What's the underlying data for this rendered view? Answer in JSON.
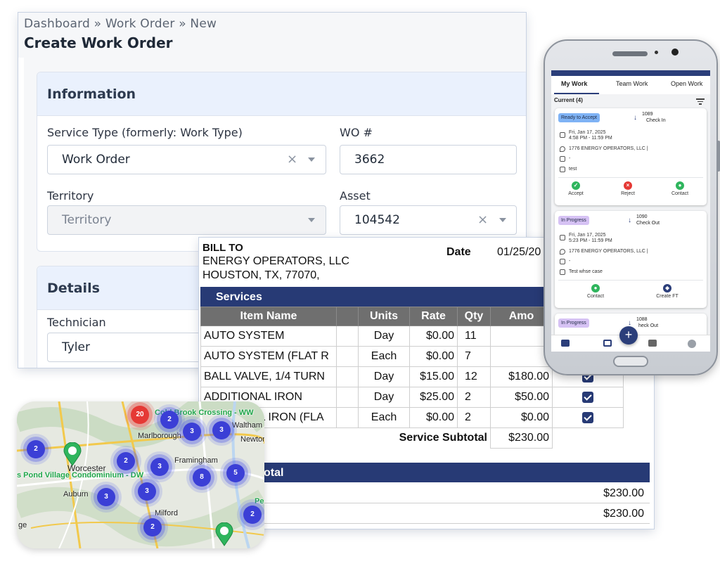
{
  "work_order_form": {
    "breadcrumb": "Dashboard » Work Order » New",
    "title": "Create Work Order",
    "information": {
      "heading": "Information",
      "service_type_label": "Service Type (formerly: Work Type)",
      "service_type_value": "Work Order",
      "wo_label": "WO #",
      "wo_value": "3662",
      "territory_label": "Territory",
      "territory_placeholder": "Territory",
      "asset_label": "Asset",
      "asset_value": "104542"
    },
    "details": {
      "heading": "Details",
      "technician_label": "Technician",
      "technician_value": "Tyler"
    }
  },
  "bill": {
    "bill_to_label": "BILL TO",
    "company": "ENERGY OPERATORS, LLC",
    "address": "HOUSTON,   TX,   77070,",
    "date_label": "Date",
    "date_value": "01/25/20",
    "services_heading": "Services",
    "columns": [
      "Item Name",
      "",
      "Units",
      "Rate",
      "Qty",
      "Amo",
      ""
    ],
    "rows": [
      {
        "item": "AUTO SYSTEM",
        "units": "Day",
        "rate": "$0.00",
        "qty": "11",
        "amount": "",
        "checked": false
      },
      {
        "item": "AUTO SYSTEM (FLAT R",
        "units": "Each",
        "rate": "$0.00",
        "qty": "7",
        "amount": "",
        "checked": false
      },
      {
        "item": "BALL VALVE, 1/4 TURN",
        "units": "Day",
        "rate": "$15.00",
        "qty": "12",
        "amount": "$180.00",
        "checked": true
      },
      {
        "item": "ADDITIONAL IRON",
        "units": "Day",
        "rate": "$25.00",
        "qty": "2",
        "amount": "$50.00",
        "checked": true
      },
      {
        "item": "AL IRON (FLA",
        "units": "Each",
        "rate": "$0.00",
        "qty": "2",
        "amount": "$0.00",
        "checked": true
      }
    ],
    "subtotal_label": "Service Subtotal",
    "subtotal_value": "$230.00",
    "total_heading": "otal",
    "total_line_1": "$230.00",
    "total_line_2": "$230.00"
  },
  "map": {
    "places": {
      "cold_brook": "Cold Brook Crossing - WW",
      "waltham": "Waltham",
      "marlborough": "Marlborough",
      "newton": "Newton",
      "worcester": "Worcester",
      "pond_village": "s Pond Village Condominium - DW",
      "framingham": "Framingham",
      "auburn": "Auburn",
      "milford": "Milford",
      "ge": "ge",
      "pe": "Pe"
    },
    "clusters": [
      "20",
      "2",
      "3",
      "3",
      "2",
      "2",
      "3",
      "8",
      "5",
      "3",
      "3",
      "2",
      "2"
    ]
  },
  "mobile": {
    "tabs": [
      "My Work",
      "Team Work",
      "Open Work"
    ],
    "current": "Current (4)",
    "cards": [
      {
        "status": "Ready to Accept",
        "number": "1089",
        "action": "Check In",
        "date": "Fri, Jan 17, 2025",
        "time": "4:58 PM - 11:59 PM",
        "location": "1776 ENERGY OPERATORS, LLC |",
        "asset": "-",
        "note": "test",
        "buttons": [
          "Accept",
          "Reject",
          "Contact"
        ]
      },
      {
        "status": "In Progress",
        "number": "1090",
        "action": "Check Out",
        "date": "Fri, Jan 17, 2025",
        "time": "5:23 PM - 11:59 PM",
        "location": "1776 ENERGY OPERATORS, LLC |",
        "asset": "-",
        "note": "Test whse case",
        "buttons": [
          "Contact",
          "Create FT"
        ]
      },
      {
        "status": "In Progress",
        "number": "1088",
        "action": "heck Out"
      }
    ],
    "fab_label": "+"
  },
  "colors": {
    "navy": "#273a75",
    "card_header": "#eaf1fd",
    "ready_badge": "#7fb3f5",
    "progress_badge": "#d6c2f4",
    "cluster": "#3b3fd6",
    "cluster_hot": "#e53935"
  },
  "icons": [
    "clear-x-icon",
    "caret-down-icon",
    "checkbox-checked-icon",
    "map-pin-icon",
    "calendar-icon",
    "location-icon",
    "box-icon",
    "note-icon",
    "check-circle-icon",
    "x-circle-icon",
    "contact-icon",
    "create-ft-icon",
    "filter-icon",
    "arrow-down-icon",
    "briefcase-icon",
    "archive-icon",
    "profile-icon",
    "plus-icon"
  ]
}
